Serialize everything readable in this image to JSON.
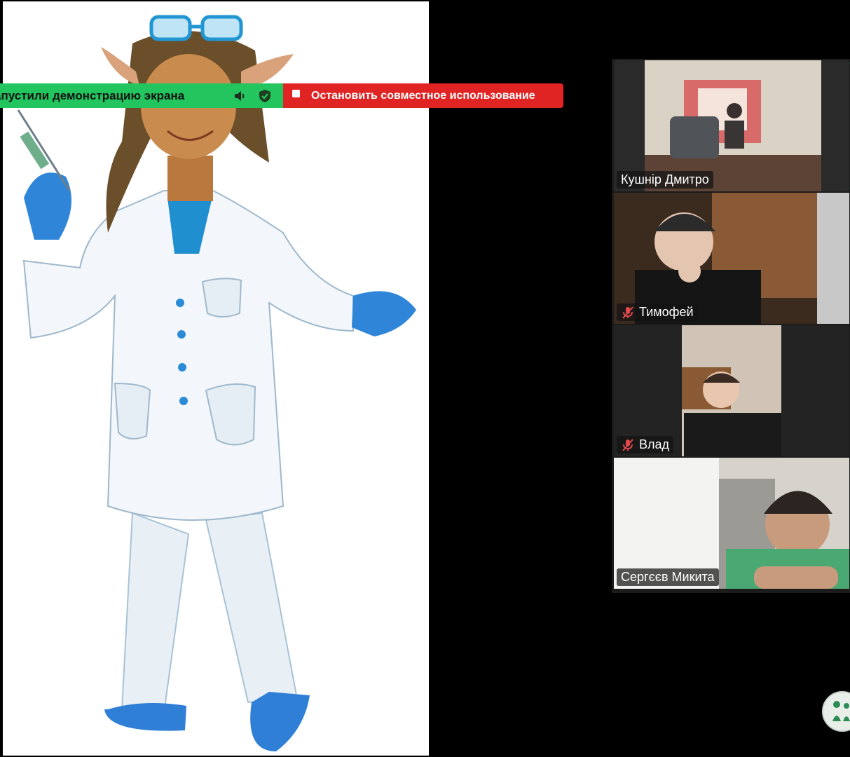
{
  "share_bar": {
    "status_text": "апустили демонстрацию экрана",
    "stop_label": "Остановить совместное использование",
    "icons": [
      "speaker-icon",
      "shield-check-icon",
      "stop-square-icon"
    ],
    "colors": {
      "status_bg": "#22c55e",
      "stop_bg": "#e02424"
    }
  },
  "gallery": {
    "active_border_color": "#3bd48a",
    "participants": [
      {
        "name": "Кушнір Дмитро",
        "muted": false,
        "active": true
      },
      {
        "name": "Тимофей",
        "muted": true,
        "active": false
      },
      {
        "name": "Влад",
        "muted": true,
        "active": false
      },
      {
        "name": "Сергєєв Микита",
        "muted": false,
        "active": false
      }
    ]
  },
  "logo": {
    "icon": "family-logo-icon"
  }
}
